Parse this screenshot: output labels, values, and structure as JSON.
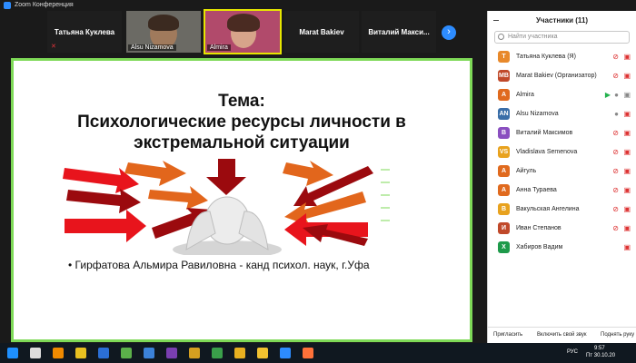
{
  "window": {
    "title": "Zoom Конференция"
  },
  "video_strip": {
    "tiles": [
      {
        "name": "Татьяна Куклева",
        "muted": true
      },
      {
        "name": "Alsu Nizamova",
        "video": true
      },
      {
        "name": "Almira",
        "video": true,
        "active": true
      },
      {
        "name": "Marat Bakiev",
        "muted": false
      },
      {
        "name": "Виталий Макси...",
        "muted": true
      }
    ],
    "next_icon": "chevron-right-icon"
  },
  "slide": {
    "title_line1": "Тема:",
    "title_line2": "Психологические ресурсы личности в",
    "title_line3": "экстремальной ситуации",
    "bullet": "• Гирфатова Альмира Равиловна -  канд психол. наук, г.Уфа",
    "colors": {
      "red": "#e8141c",
      "dark_red": "#9b0a0e",
      "orange": "#e2661c",
      "green": "#7ed957"
    }
  },
  "participants_panel": {
    "header": "Участники (11)",
    "search_placeholder": "Найти участника",
    "participants": [
      {
        "initials": "Т",
        "name": "Татьяна Куклева (Я)",
        "color": "#e8892b",
        "mic": "muted",
        "video": "off"
      },
      {
        "initials": "MB",
        "name": "Marat Bakiev (Организатор)",
        "color": "#c0492a",
        "mic": "muted",
        "video": "off"
      },
      {
        "initials": "A",
        "name": "Almira",
        "color": "#e06a1e",
        "mic": "on",
        "video": "on"
      },
      {
        "initials": "AN",
        "name": "Alsu Nizamova",
        "color": "#3a6ea8",
        "mic": "on",
        "video": "off"
      },
      {
        "initials": "В",
        "name": "Виталий Максимов",
        "color": "#8a4fc0",
        "mic": "muted",
        "video": "off"
      },
      {
        "initials": "VS",
        "name": "Vladislava Semenova",
        "color": "#e8a21e",
        "mic": "muted",
        "video": "off"
      },
      {
        "initials": "A",
        "name": "Айгуль",
        "color": "#e06a1e",
        "mic": "muted",
        "video": "off"
      },
      {
        "initials": "A",
        "name": "Анна Тураева",
        "color": "#e06a1e",
        "mic": "muted",
        "video": "off"
      },
      {
        "initials": "В",
        "name": "Вакульская Ангелина",
        "color": "#e8a21e",
        "mic": "muted",
        "video": "off"
      },
      {
        "initials": "И",
        "name": "Иван Степанов",
        "color": "#c0492a",
        "mic": "muted",
        "video": "off"
      },
      {
        "initials": "Х",
        "name": "Хабиров Вадим",
        "color": "#1e9a4a",
        "mic": "none",
        "video": "off"
      }
    ],
    "footer": {
      "invite": "Пригласить",
      "unmute": "Включить свой звук",
      "raise_hand": "Поднять руку"
    }
  },
  "taskbar": {
    "clock_time": "9:57",
    "clock_date": "Пт 30.10.20",
    "language": "РУС",
    "icons": [
      "windows-icon",
      "search-icon",
      "vlc-icon",
      "chrome-icon",
      "app-icon",
      "app-icon",
      "app-icon",
      "app-icon",
      "app-icon",
      "app-icon",
      "chrome-icon",
      "folder-icon",
      "zoom-icon",
      "firefox-icon"
    ]
  }
}
